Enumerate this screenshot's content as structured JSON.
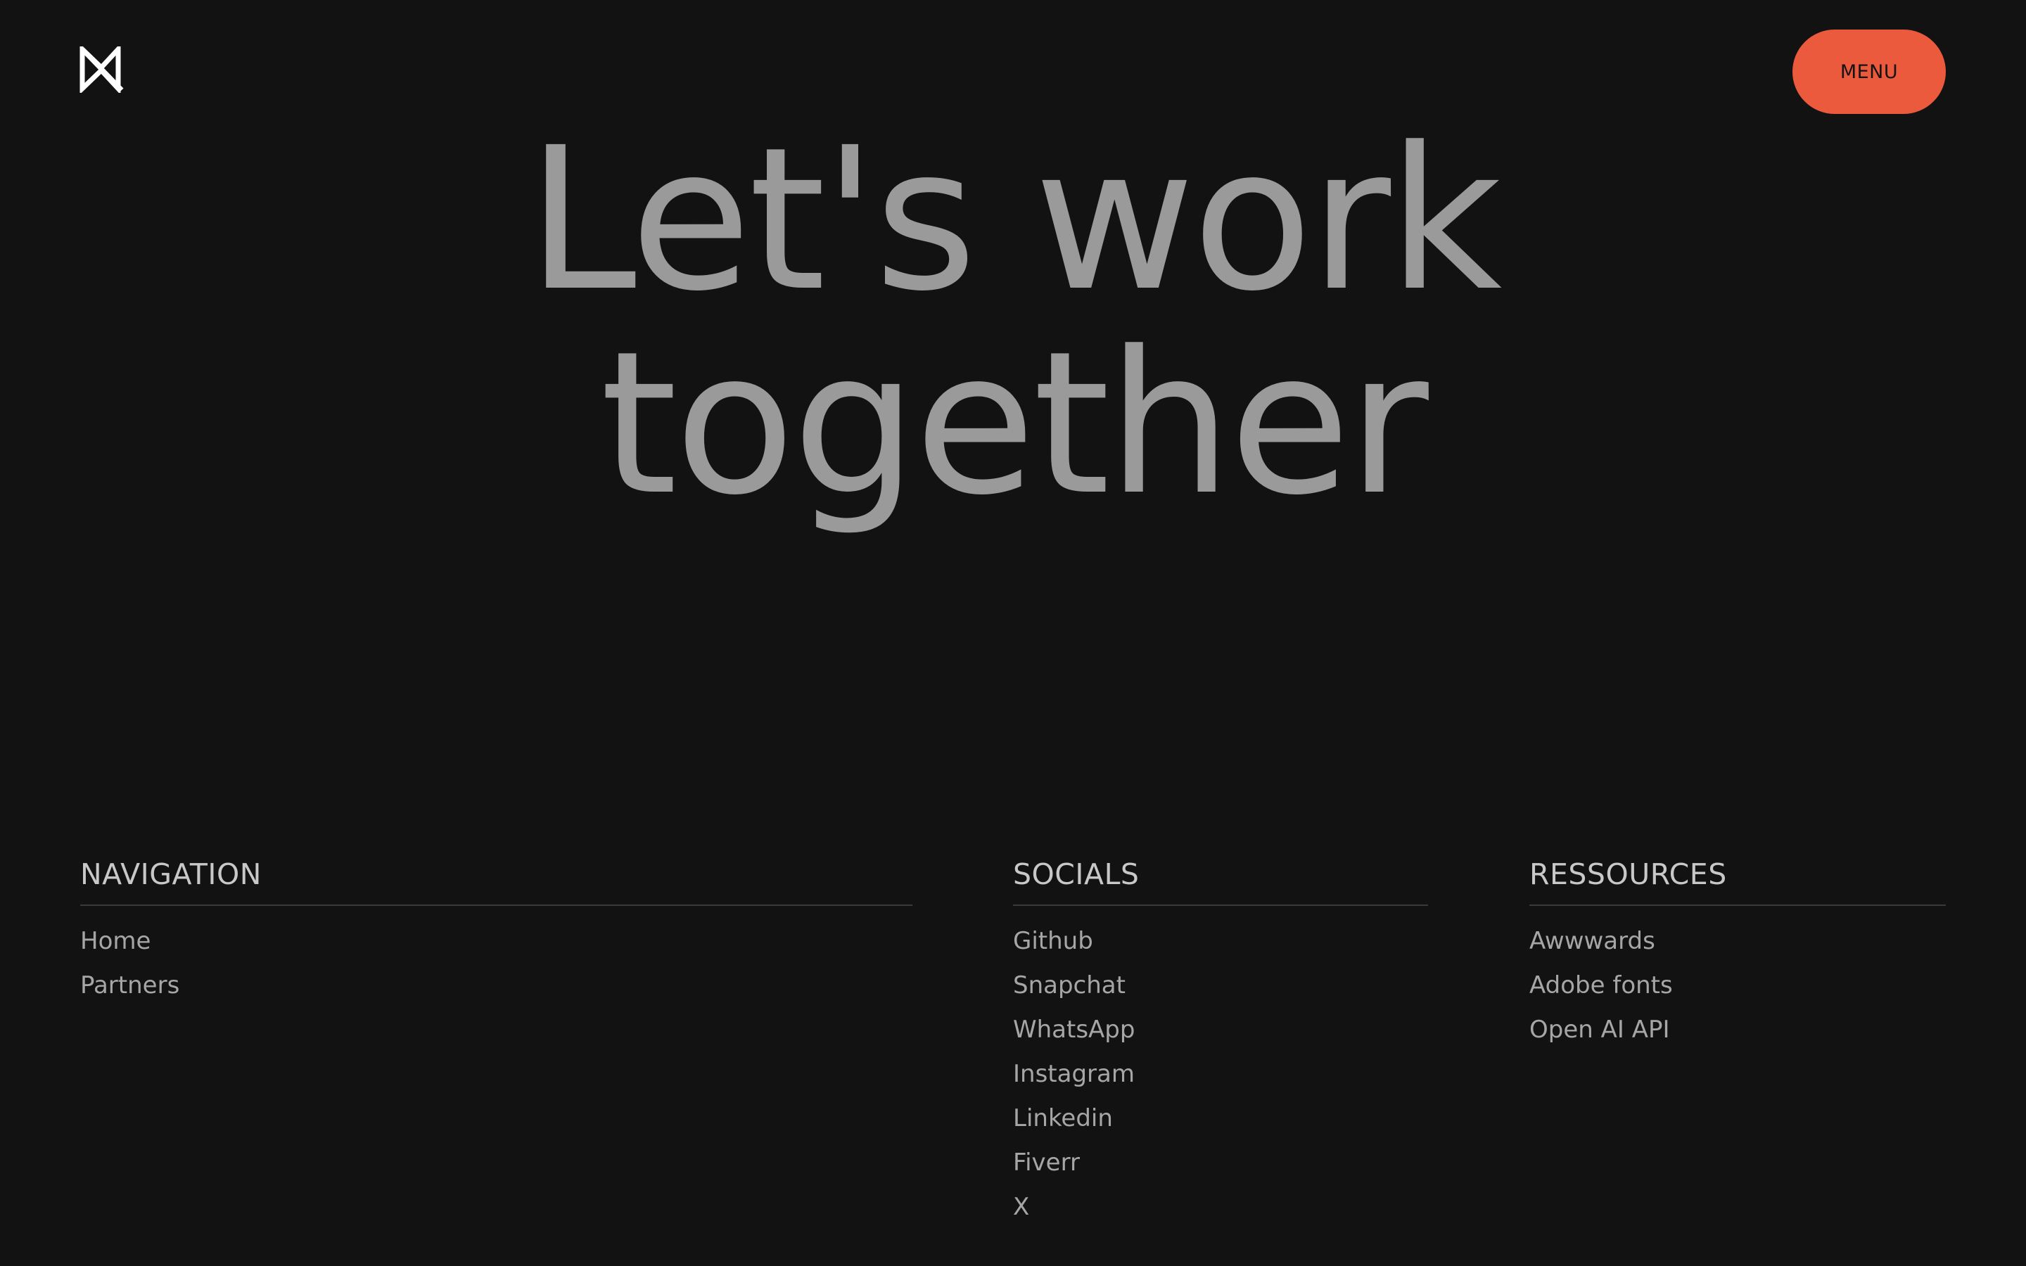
{
  "header": {
    "logo_icon": "monogram-logo-icon",
    "menu_label": "MENU",
    "menu_color": "#eb5a3c"
  },
  "hero": {
    "line1": "Let's work",
    "line2": "together"
  },
  "footer": {
    "navigation": {
      "heading": "NAVIGATION",
      "links": [
        "Home",
        "Partners"
      ]
    },
    "socials": {
      "heading": "SOCIALS",
      "links": [
        "Github",
        "Snapchat",
        "WhatsApp",
        "Instagram",
        "Linkedin",
        "Fiverr",
        "X"
      ]
    },
    "resources": {
      "heading": "RESSOURCES",
      "links": [
        "Awwwards",
        "Adobe fonts",
        "Open AI API"
      ]
    }
  },
  "colors": {
    "background": "#121212",
    "text": "#9a9a9a",
    "accent": "#eb5a3c"
  }
}
